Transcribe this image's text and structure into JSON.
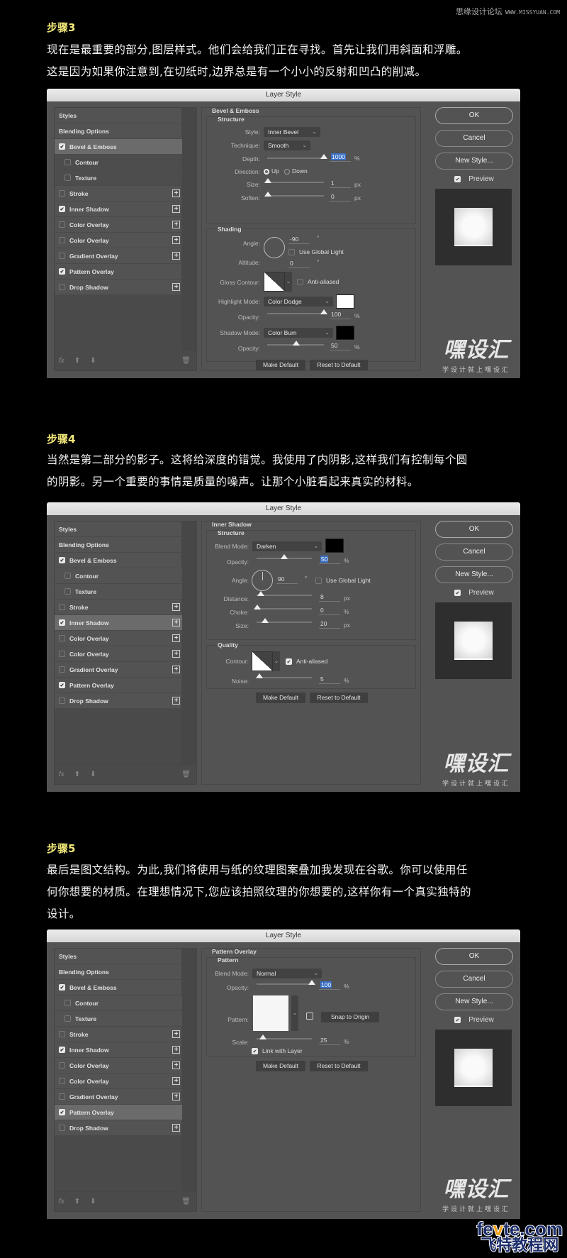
{
  "site_mark": {
    "cn": "思缘设计论坛",
    "url": "WWW.MISSYUAN.COM"
  },
  "steps": [
    {
      "title": "步骤3",
      "lines": [
        "现在是最重要的部分,图层样式。他们会给我们正在寻找。首先让我们用斜面和浮雕。",
        "这是因为如果你注意到,在切纸时,边界总是有一个小小的反射和凹凸的削减。"
      ]
    },
    {
      "title": "步骤4",
      "lines": [
        "当然是第二部分的影子。这将给深度的错觉。我使用了内阴影,这样我们有控制每个圆",
        "的阴影。另一个重要的事情是质量的噪声。让那个小脏看起来真实的材料。"
      ]
    },
    {
      "title": "步骤5",
      "lines": [
        "最后是图文结构。为此,我们将使用与纸的纹理图案叠加我发现在谷歌。你可以使用任",
        "何你想要的材质。在理想情况下,您应该拍照纹理的你想要的,这样你有一个真实独特的",
        "设计。"
      ]
    }
  ],
  "dialog": {
    "title": "Layer Style",
    "styles_header": "Styles",
    "blending_options": "Blending Options",
    "items": [
      "Bevel & Emboss",
      "Contour",
      "Texture",
      "Stroke",
      "Inner Shadow",
      "Color Overlay",
      "Color Overlay",
      "Gradient Overlay",
      "Pattern Overlay",
      "Drop Shadow"
    ],
    "ok": "OK",
    "cancel": "Cancel",
    "new_style": "New Style...",
    "preview": "Preview",
    "make_default": "Make Default",
    "reset_default": "Reset to Default",
    "fx": "fx",
    "logo_big": "嘿设汇",
    "logo_small": "学设计就上嘿设汇"
  },
  "bevel": {
    "section": "Bevel & Emboss",
    "structure": "Structure",
    "style_label": "Style:",
    "style_value": "Inner Bevel",
    "technique_label": "Technique:",
    "technique_value": "Smooth",
    "depth_label": "Depth:",
    "depth_value": "1000",
    "depth_unit": "%",
    "direction_label": "Direction:",
    "direction_up": "Up",
    "direction_down": "Down",
    "size_label": "Size:",
    "size_value": "1",
    "size_unit": "px",
    "soften_label": "Soften:",
    "soften_value": "0",
    "soften_unit": "px",
    "shading": "Shading",
    "angle_label": "Angle:",
    "angle_value": "-90",
    "deg": "°",
    "global_light": "Use Global Light",
    "altitude_label": "Altitude:",
    "altitude_value": "0",
    "gloss_label": "Gloss Contour:",
    "anti_aliased": "Anti-aliased",
    "highlight_label": "Highlight Mode:",
    "highlight_value": "Color Dodge",
    "highlight_color": "#ffffff",
    "hopacity_label": "Opacity:",
    "hopacity_value": "100",
    "pct": "%",
    "shadow_label": "Shadow Mode:",
    "shadow_value": "Color Burn",
    "shadow_color": "#000000",
    "sopacity_label": "Opacity:",
    "sopacity_value": "50"
  },
  "inner_shadow": {
    "section": "Inner Shadow",
    "structure": "Structure",
    "blend_label": "Blend Mode:",
    "blend_value": "Darken",
    "color": "#000000",
    "opacity_label": "Opacity:",
    "opacity_value": "50",
    "pct": "%",
    "angle_label": "Angle:",
    "angle_value": "90",
    "deg": "°",
    "global_light": "Use Global Light",
    "distance_label": "Distance:",
    "distance_value": "8",
    "px": "px",
    "choke_label": "Choke:",
    "choke_value": "0",
    "size_label": "Size:",
    "size_value": "20",
    "quality": "Quality",
    "contour_label": "Contour:",
    "anti_aliased": "Anti-aliased",
    "noise_label": "Noise:",
    "noise_value": "5"
  },
  "pattern": {
    "section": "Pattern Overlay",
    "sub": "Pattern",
    "blend_label": "Blend Mode:",
    "blend_value": "Normal",
    "opacity_label": "Opacity:",
    "opacity_value": "100",
    "pct": "%",
    "pattern_label": "Pattern:",
    "snap": "Snap to Origin",
    "scale_label": "Scale:",
    "scale_value": "25",
    "link": "Link with Layer"
  },
  "watermark": {
    "line1_a": "fe",
    "line1_v": "v",
    "line1_b": "te.com",
    "line2": "飞特教程网"
  }
}
